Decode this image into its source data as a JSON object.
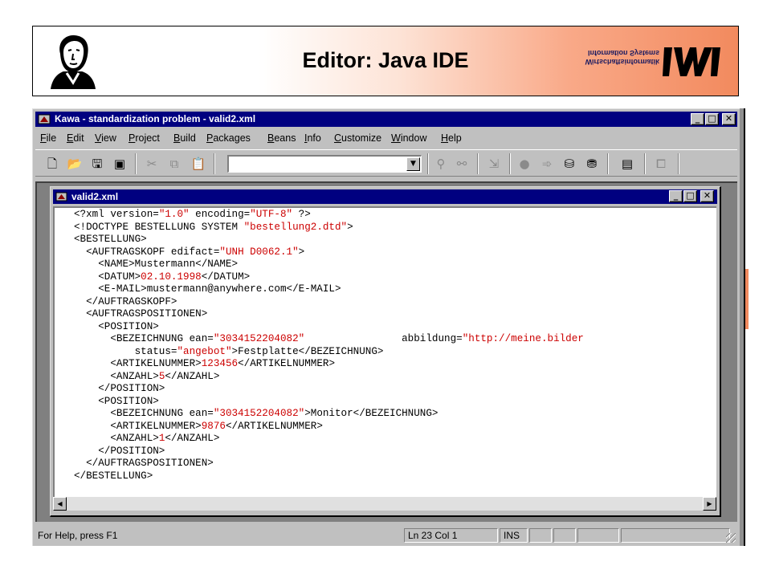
{
  "slide": {
    "title": "Editor: Java IDE",
    "logo_text": [
      "Wirtschaftsinformatik",
      "Information Systems"
    ]
  },
  "app": {
    "title": "Kawa - standardization problem - valid2.xml",
    "menu": [
      "File",
      "Edit",
      "View",
      "Project",
      "Build",
      "Packages",
      "Beans",
      "Info",
      "Customize",
      "Window",
      "Help"
    ],
    "toolbar_icons": [
      "new-file-icon",
      "open-folder-icon",
      "save-icon",
      "save-all-icon",
      "cut-icon",
      "copy-icon",
      "paste-icon",
      "find-icon",
      "replace-icon",
      "goto-icon",
      "breakpoint-icon",
      "step-icon",
      "compile-icon",
      "build-icon",
      "run-icon",
      "window-icon"
    ],
    "combo_value": ""
  },
  "document": {
    "title": "valid2.xml",
    "code_lines": [
      [
        {
          "t": "<?xml version="
        },
        {
          "t": "\"1.0\"",
          "s": 1
        },
        {
          "t": " encoding="
        },
        {
          "t": "\"UTF-8\"",
          "s": 1
        },
        {
          "t": " ?>"
        }
      ],
      [
        {
          "t": "<!DOCTYPE BESTELLUNG SYSTEM "
        },
        {
          "t": "\"bestellung2.dtd\"",
          "s": 1
        },
        {
          "t": ">"
        }
      ],
      [
        {
          "t": "<BESTELLUNG>"
        }
      ],
      [
        {
          "t": "  <AUFTRAGSKOPF edifact="
        },
        {
          "t": "\"UNH D0062.1\"",
          "s": 1
        },
        {
          "t": ">"
        }
      ],
      [
        {
          "t": "    <NAME>Mustermann</NAME>"
        }
      ],
      [
        {
          "t": "    <DATUM>"
        },
        {
          "t": "02.10.1998",
          "s": 1
        },
        {
          "t": "</DATUM>"
        }
      ],
      [
        {
          "t": "    <E-MAIL>mustermann@anywhere.com</E-MAIL>"
        }
      ],
      [
        {
          "t": "  </AUFTRAGSKOPF>"
        }
      ],
      [
        {
          "t": "  <AUFTRAGSPOSITIONEN>"
        }
      ],
      [
        {
          "t": "    <POSITION>"
        }
      ],
      [
        {
          "t": "      <BEZEICHNUNG ean="
        },
        {
          "t": "\"3034152204082\"",
          "s": 1
        },
        {
          "t": "                abbildung="
        },
        {
          "t": "\"http://meine.bilder",
          "s": 1
        }
      ],
      [
        {
          "t": "          status="
        },
        {
          "t": "\"angebot\"",
          "s": 1
        },
        {
          "t": ">Festplatte</BEZEICHNUNG>"
        }
      ],
      [
        {
          "t": "      <ARTIKELNUMMER>"
        },
        {
          "t": "123456",
          "s": 1
        },
        {
          "t": "</ARTIKELNUMMER>"
        }
      ],
      [
        {
          "t": "      <ANZAHL>"
        },
        {
          "t": "5",
          "s": 1
        },
        {
          "t": "</ANZAHL>"
        }
      ],
      [
        {
          "t": "    </POSITION>"
        }
      ],
      [
        {
          "t": "    <POSITION>"
        }
      ],
      [
        {
          "t": "      <BEZEICHNUNG ean="
        },
        {
          "t": "\"3034152204082\"",
          "s": 1
        },
        {
          "t": ">Monitor</BEZEICHNUNG>"
        }
      ],
      [
        {
          "t": "      <ARTIKELNUMMER>"
        },
        {
          "t": "9876",
          "s": 1
        },
        {
          "t": "</ARTIKELNUMMER>"
        }
      ],
      [
        {
          "t": "      <ANZAHL>"
        },
        {
          "t": "1",
          "s": 1
        },
        {
          "t": "</ANZAHL>"
        }
      ],
      [
        {
          "t": "    </POSITION>"
        }
      ],
      [
        {
          "t": "  </AUFTRAGSPOSITIONEN>"
        }
      ],
      [
        {
          "t": "</BESTELLUNG>"
        }
      ]
    ]
  },
  "status": {
    "help": "For Help, press F1",
    "position": "Ln 23 Col 1",
    "mode": "INS"
  },
  "colors": {
    "title_bar": "#000080",
    "string_literal": "#cc0000",
    "header_accent": "#f28a5e"
  }
}
